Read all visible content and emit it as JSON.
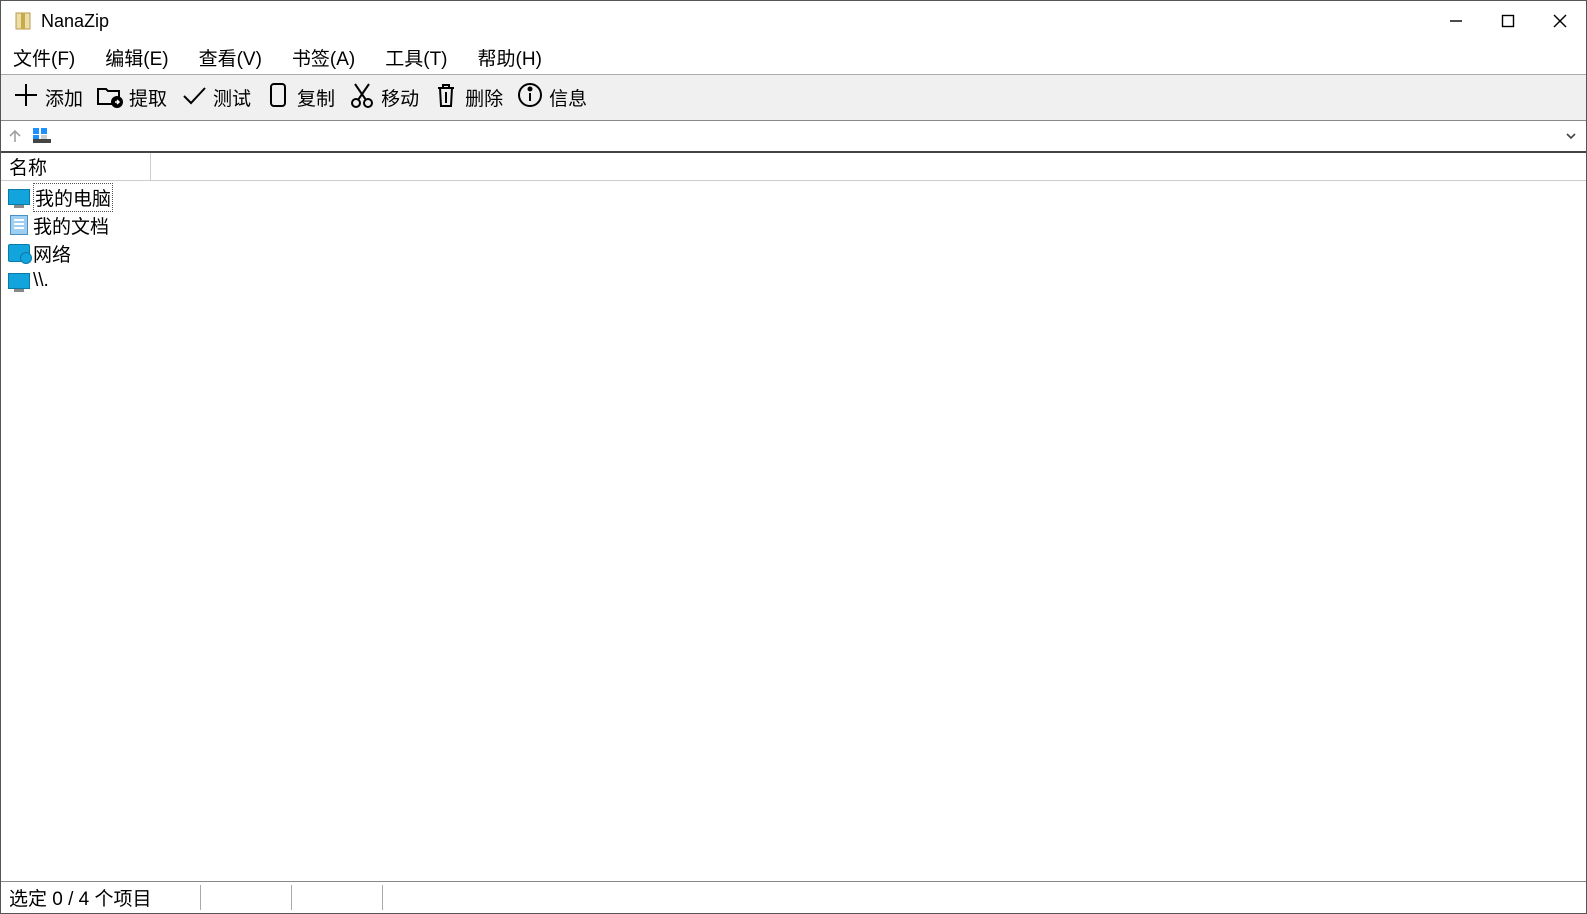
{
  "title": "NanaZip",
  "menu": {
    "file": "文件(F)",
    "edit": "编辑(E)",
    "view": "查看(V)",
    "bookmark": "书签(A)",
    "tools": "工具(T)",
    "help": "帮助(H)"
  },
  "toolbar": {
    "add": "添加",
    "extract": "提取",
    "test": "测试",
    "copy": "复制",
    "move": "移动",
    "delete": "删除",
    "info": "信息"
  },
  "address": {
    "path": ""
  },
  "columns": {
    "name": "名称"
  },
  "rows": [
    {
      "name": "我的电脑",
      "icon": "monitor",
      "selected": true
    },
    {
      "name": "我的文档",
      "icon": "doc",
      "selected": false
    },
    {
      "name": "网络",
      "icon": "net",
      "selected": false
    },
    {
      "name": "\\\\.",
      "icon": "monitor2",
      "selected": false
    }
  ],
  "status": {
    "selection": "选定 0 / 4 个项目"
  }
}
